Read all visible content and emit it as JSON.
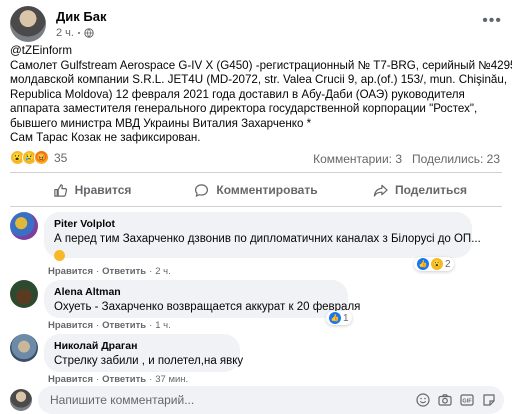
{
  "post": {
    "author": "Дик Бак",
    "time": "2 ч.",
    "more_icon": "more-horizontal-icon",
    "privacy_icon": "globe-icon",
    "text_lines": [
      "@tZEinform",
      "Самолет Gulfstream Aerospace G-IV X (G450) -регистрационный № T7-BRG,  серийный №4295",
      "молдавской компании S.R.L. JET4U (MD-2072, str. Valea Crucii 9, ap.(of.) 153/, mun. Chişinău,",
      "Republica Moldova)  12 февраля 2021 года доставил в Абу-Даби (ОАЭ) руководителя",
      "аппарата заместителя  генерального директора государственной корпорации \"Ростех\",",
      "бывшего министра МВД Украины  Виталия Захарченко *",
      "Сам Тарас Козак  не зафиксирован."
    ],
    "reaction_count": "35",
    "comments_count": "Комментарии: 3",
    "shares_count": "Поделились: 23"
  },
  "actions": {
    "like": "Нравится",
    "comment": "Комментировать",
    "share": "Поделиться"
  },
  "comments": [
    {
      "name": "Piter Volplot",
      "text": "А перед тим Захарченко дзвонив по дипломатичних каналах з Білорусі до ОП...",
      "like_label": "Нравится",
      "reply_label": "Ответить",
      "time": "2 ч.",
      "reaction_count": "2"
    },
    {
      "name": "Alena Altman",
      "text": "Охуеть - Захарченко возвращается аккурат к 20 февраля",
      "like_label": "Нравится",
      "reply_label": "Ответить",
      "time": "1 ч.",
      "reaction_count": "1"
    },
    {
      "name": "Николай Драган",
      "text": "Стрелку забили , и полетел,на явку",
      "like_label": "Нравится",
      "reply_label": "Ответить",
      "time": "37 мин."
    }
  ],
  "composer": {
    "placeholder": "Напишите комментарий..."
  },
  "colors": {
    "accent": "#1877f2",
    "muted": "#65676b",
    "bubble": "#f0f2f5"
  }
}
